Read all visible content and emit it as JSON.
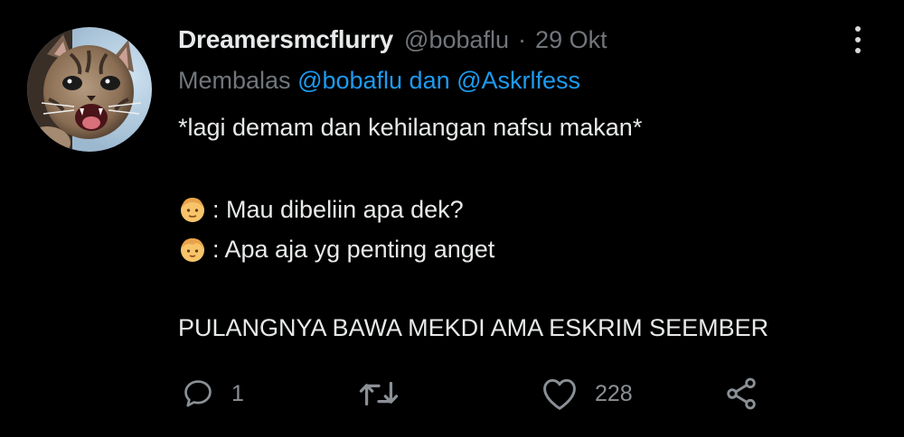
{
  "tweet": {
    "display_name": "Dreamersmcflurry",
    "handle": "@bobaflu",
    "separator": "·",
    "date": "29 Okt",
    "reply_prefix": "Membalas",
    "reply_mentions": "@bobaflu dan @Askrlfess",
    "lines": {
      "line1": "*lagi demam dan kehilangan nafsu makan*",
      "line2": ": Mau dibeliin apa dek?",
      "line3": ": Apa aja yg penting anget",
      "line4": "PULANGNYA BAWA MEKDI AMA ESKRIM SEEMBER"
    },
    "emoji": {
      "line2": "adult-face-emoji",
      "line3": "child-face-emoji"
    },
    "avatar": "kitten-avatar",
    "actions": {
      "reply_count": "1",
      "retweet_count": "",
      "like_count": "228",
      "share_icon": "share-icon"
    }
  },
  "colors": {
    "background": "#000000",
    "primary_text": "#e7e9ea",
    "secondary_text": "#71767b",
    "mention": "#1d9bf0"
  }
}
